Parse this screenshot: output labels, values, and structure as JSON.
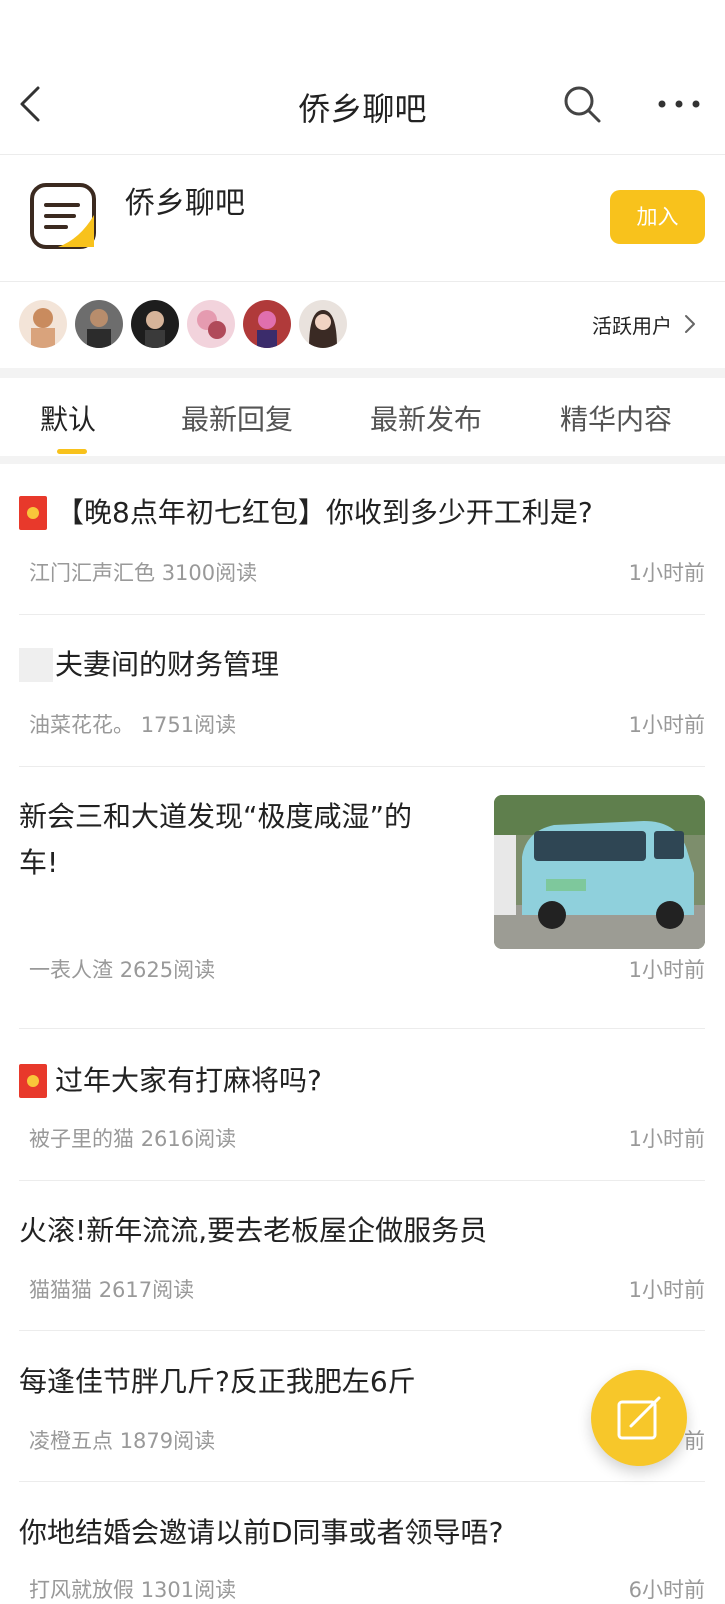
{
  "header": {
    "title": "侨乡聊吧"
  },
  "group": {
    "name": "侨乡聊吧",
    "join_label": "加入"
  },
  "members": {
    "active_users_label": "活跃用户"
  },
  "tabs": [
    {
      "label": "默认",
      "active": true
    },
    {
      "label": "最新回复",
      "active": false
    },
    {
      "label": "最新发布",
      "active": false
    },
    {
      "label": "精华内容",
      "active": false
    }
  ],
  "posts": [
    {
      "title": "【晚8点年初七红包】你收到多少开工利是?",
      "author": "江门汇声汇色",
      "reads": "3100阅读",
      "time": "1小时前",
      "badge": "red-packet-icon"
    },
    {
      "title": "夫妻间的财务管理",
      "author": "油菜花花。",
      "reads": "1751阅读",
      "time": "1小时前",
      "badge": "blank"
    },
    {
      "title_line1": "新会三和大道发现“极度咸湿”的",
      "title_line2": "车!",
      "author": "一表人渣",
      "reads": "2625阅读",
      "time": "1小时前"
    },
    {
      "title": "过年大家有打麻将吗?",
      "author": "被子里的猫",
      "reads": "2616阅读",
      "time": "1小时前",
      "badge": "red-packet-icon"
    },
    {
      "title": "火滚!新年流流,要去老板屋企做服务员",
      "author": "猫猫猫",
      "reads": "2617阅读",
      "time": "1小时前"
    },
    {
      "title": "每逢佳节胖几斤?反正我肥左6斤",
      "author": "凌橙五点",
      "reads": "1879阅读",
      "time": "前"
    },
    {
      "title": "你地结婚会邀请以前D同事或者领导唔?",
      "author": "打风就放假",
      "reads": "1301阅读",
      "time": "6小时前"
    }
  ],
  "colors": {
    "accent": "#f8c21c",
    "badge_red": "#e8392b",
    "meta_gray": "#999999"
  }
}
